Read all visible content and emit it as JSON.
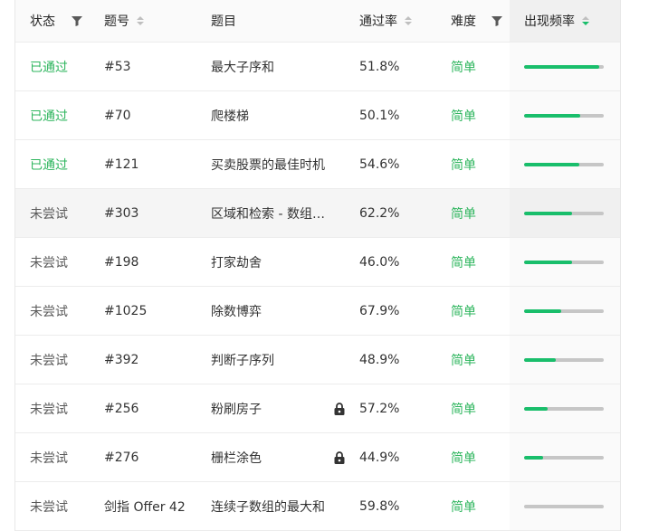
{
  "columns": {
    "status": "状态",
    "id": "题号",
    "title": "题目",
    "rate": "通过率",
    "difficulty": "难度",
    "frequency": "出现频率"
  },
  "colors": {
    "accent": "#19be6b",
    "passed": "#2db55d",
    "bar_track": "#c6c6c6"
  },
  "rows": [
    {
      "status": "已通过",
      "passed": true,
      "id": "#53",
      "title": "最大子序和",
      "locked": false,
      "rate": "51.8%",
      "difficulty": "简单",
      "frequency": 0.94,
      "highlight": false
    },
    {
      "status": "已通过",
      "passed": true,
      "id": "#70",
      "title": "爬楼梯",
      "locked": false,
      "rate": "50.1%",
      "difficulty": "简单",
      "frequency": 0.7,
      "highlight": false
    },
    {
      "status": "已通过",
      "passed": true,
      "id": "#121",
      "title": "买卖股票的最佳时机",
      "locked": false,
      "rate": "54.6%",
      "difficulty": "简单",
      "frequency": 0.69,
      "highlight": false
    },
    {
      "status": "未尝试",
      "passed": false,
      "id": "#303",
      "title": "区域和检索 - 数组不可变",
      "locked": false,
      "rate": "62.2%",
      "difficulty": "简单",
      "frequency": 0.6,
      "highlight": true
    },
    {
      "status": "未尝试",
      "passed": false,
      "id": "#198",
      "title": "打家劫舍",
      "locked": false,
      "rate": "46.0%",
      "difficulty": "简单",
      "frequency": 0.6,
      "highlight": false
    },
    {
      "status": "未尝试",
      "passed": false,
      "id": "#1025",
      "title": "除数博弈",
      "locked": false,
      "rate": "67.9%",
      "difficulty": "简单",
      "frequency": 0.47,
      "highlight": false
    },
    {
      "status": "未尝试",
      "passed": false,
      "id": "#392",
      "title": "判断子序列",
      "locked": false,
      "rate": "48.9%",
      "difficulty": "简单",
      "frequency": 0.4,
      "highlight": false
    },
    {
      "status": "未尝试",
      "passed": false,
      "id": "#256",
      "title": "粉刷房子",
      "locked": true,
      "rate": "57.2%",
      "difficulty": "简单",
      "frequency": 0.29,
      "highlight": false
    },
    {
      "status": "未尝试",
      "passed": false,
      "id": "#276",
      "title": "栅栏涂色",
      "locked": true,
      "rate": "44.9%",
      "difficulty": "简单",
      "frequency": 0.24,
      "highlight": false
    },
    {
      "status": "未尝试",
      "passed": false,
      "id": "剑指 Offer 42",
      "title": "连续子数组的最大和",
      "locked": false,
      "rate": "59.8%",
      "difficulty": "简单",
      "frequency": 0.0,
      "highlight": false
    }
  ]
}
